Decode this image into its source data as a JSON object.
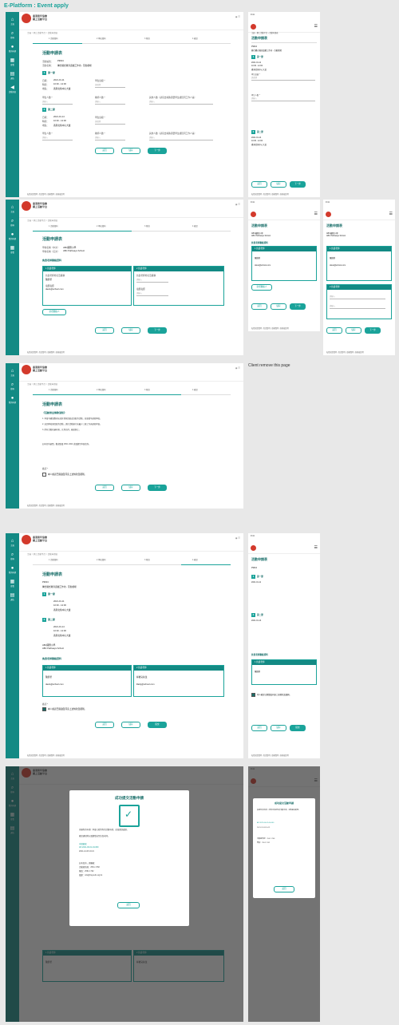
{
  "header": {
    "title": "E-Platform : Event apply"
  },
  "note": "Client remove this page",
  "app": {
    "logo_line1": "香港青年協會",
    "logo_line2": "網上活動平台",
    "breadcrumb": "主頁 > 網上活動平台 > 活動申請表",
    "footer": "私隱政策聲明 | 免責聲明 | 版權聲明 | 無障礙說明",
    "sidebar": [
      "主頁",
      "搜尋",
      "我的申請",
      "查看",
      "通告",
      "活動消息"
    ]
  },
  "steps": [
    "1 活動資料",
    "2 學校資料",
    "3 條款",
    "4 確認"
  ],
  "form": {
    "title": "活動申請表",
    "event_no_label": "活動編號：",
    "event_no": "P9604",
    "event_name_label": "活動名稱：",
    "event_name": "轉合體式教育遊戲工作坊 - 互動劇場",
    "session1": "第一節",
    "session2": "第二節",
    "date_label": "日期：",
    "date1": "2021-01-11",
    "date2": "2021-01-14",
    "time_label": "時間：",
    "time1": "10:30 - 12:00",
    "time2": "10:30 - 12:00",
    "venue_label": "地點：",
    "venue": "香港北角中心大廈",
    "grade_label": "學生班級 *",
    "students_label": "學生人數 *",
    "teachers_label": "教師人數 *",
    "remarks_label": "其他人數（請寫出特殊需要學生或陪同工作人員）",
    "select_placeholder": "請選擇",
    "input_placeholder": "請輸入"
  },
  "school": {
    "name_zh_label": "學校名稱（中文）",
    "name_zh": "ABC國際小學",
    "name_en_label": "學校名稱（英文）",
    "name_en": "ABC Pathways School",
    "contacts_title": "負責老師聯絡資料",
    "contact1_title": "1 負責老師",
    "contact2_title": "2 負責老師",
    "teacher_name_label": "負責老師姓名及職稱",
    "teacher1": "陳錦華",
    "teacher2": "林寶兒先生",
    "email_label": "電郵電郵",
    "email1": "davis@school.com",
    "email2": "lilady@school.com",
    "add_contact": "新增聯絡人"
  },
  "terms": {
    "title": "《活動推出條款須知》",
    "line1": "1. 本會有權因應天氣或其他原因更改或取消活動，並會盡早通知學校。",
    "line2": "2. 如因學校原因取消活動，請於活動舉行前最少三個工作天通知本會。",
    "line3": "3. 所有活動名額有限，先到先得，額滿即止。",
    "contact": "如有任何疑問，歡迎致電 2561 2304 或電郵至本會查詢。",
    "agree_label": "確認 *",
    "agree": "本人確認已閱讀及同意上述條款及細則。"
  },
  "buttons": {
    "prev": "返回",
    "save": "儲存",
    "next": "下一步",
    "submit": "提交"
  },
  "modal": {
    "title": "成功提交活動申請",
    "body1": "多謝你的申請！本會已收到你的活動申請，並會盡快處理。",
    "body2": "確認通知將以電郵發送至負責老師。",
    "ref_label": "申請編號",
    "ref": "AP-2021-00-01-04-660",
    "date": "2021-12-03 10:21",
    "contact_label": "如有查詢，請聯絡：",
    "contact_lines": [
      "活動組熱線：2561 1768",
      "傳真：2561 1762",
      "電郵：info@hkyouth.org.hk"
    ],
    "close": "返回"
  },
  "mobile": {
    "time": "9:41"
  }
}
